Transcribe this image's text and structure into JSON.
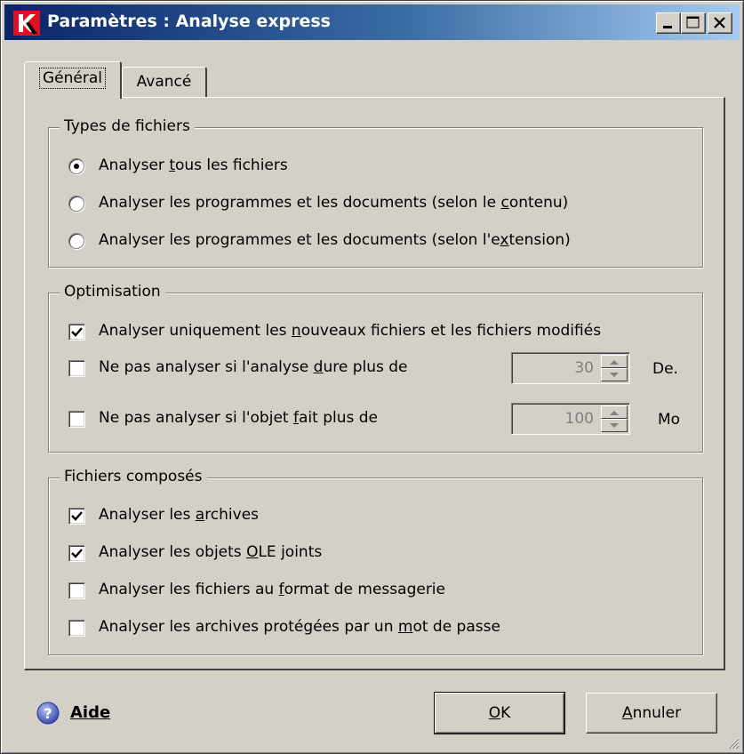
{
  "window": {
    "title": "Paramètres : Analyse express",
    "app_icon": "kaspersky-k-icon",
    "controls": [
      "minimize-icon",
      "maximize-icon",
      "close-icon"
    ]
  },
  "tabs": [
    {
      "label": "Général",
      "active": true
    },
    {
      "label": "Avancé",
      "active": false
    }
  ],
  "file_types": {
    "title": "Types de fichiers",
    "options": [
      {
        "pre": "Analyser ",
        "key": "t",
        "post": "ous les fichiers",
        "checked": true
      },
      {
        "pre": "Analyser les programmes et les documents (selon le ",
        "key": "c",
        "post": "ontenu)",
        "checked": false
      },
      {
        "pre": "Analyser les programmes et les documents (selon l'e",
        "key": "x",
        "post": "tension)",
        "checked": false
      }
    ]
  },
  "optimisation": {
    "title": "Optimisation",
    "only_new": {
      "pre": "Analyser uniquement les ",
      "key": "n",
      "post": "ouveaux fichiers et les fichiers modifiés",
      "checked": true
    },
    "duration": {
      "pre": "Ne pas analyser si l'analyse ",
      "key": "d",
      "post": "ure plus de",
      "checked": false,
      "value": "30",
      "unit": "De."
    },
    "size": {
      "pre": "Ne pas analyser si l'objet ",
      "key": "f",
      "post": "ait plus de",
      "checked": false,
      "value": "100",
      "unit": "Mo"
    }
  },
  "compound": {
    "title": "Fichiers composés",
    "options": [
      {
        "pre": "Analyser les ",
        "key": "a",
        "post": "rchives",
        "checked": true
      },
      {
        "pre": "Analyser les objets ",
        "key": "O",
        "post": "LE joints",
        "checked": true
      },
      {
        "pre": "Analyser les fichiers au ",
        "key": "f",
        "post": "ormat de messagerie",
        "checked": false
      },
      {
        "pre": "Analyser les archives protégées par un ",
        "key": "m",
        "post": "ot de passe",
        "checked": false
      }
    ]
  },
  "footer": {
    "help_label": "Aide",
    "ok_key": "O",
    "ok_rest": "K",
    "cancel_key": "A",
    "cancel_rest": "nnuler"
  }
}
